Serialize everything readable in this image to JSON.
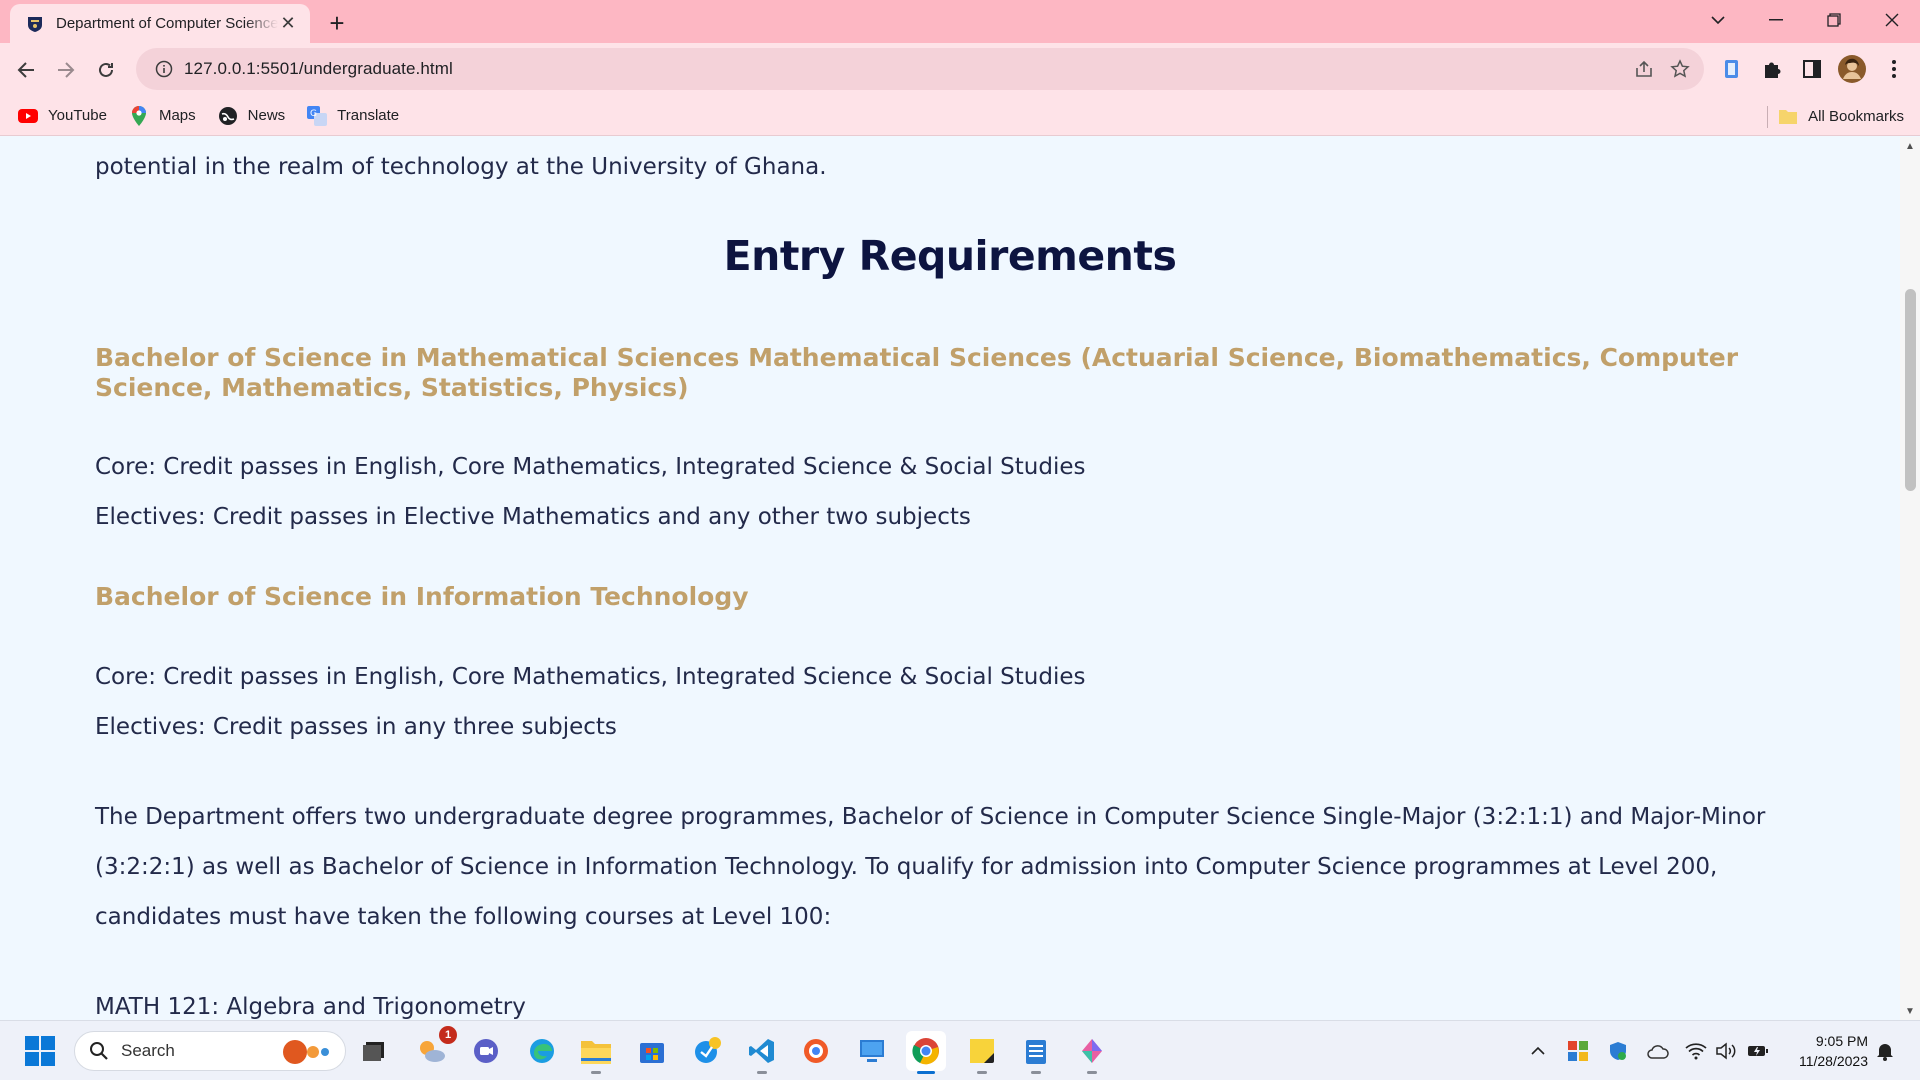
{
  "browser": {
    "tab_title": "Department of Computer Science",
    "url": "127.0.0.1:5501/undergraduate.html",
    "bookmarks": [
      {
        "label": "YouTube",
        "icon": "youtube-icon"
      },
      {
        "label": "Maps",
        "icon": "maps-icon"
      },
      {
        "label": "News",
        "icon": "news-icon"
      },
      {
        "label": "Translate",
        "icon": "translate-icon"
      }
    ],
    "all_bookmarks": "All Bookmarks"
  },
  "page": {
    "intro_tail": "potential in the realm of technology at the University of Ghana.",
    "heading": "Entry Requirements",
    "programmes": [
      {
        "title": "Bachelor of Science in Mathematical Sciences Mathematical Sciences (Actuarial Science, Biomathematics, Computer Science, Mathematics, Statistics, Physics)",
        "core": "Core: Credit passes in English, Core Mathematics, Integrated Science & Social Studies",
        "electives": "Electives: Credit passes in Elective Mathematics and any other two subjects"
      },
      {
        "title": "Bachelor of Science in Information Technology",
        "core": "Core: Credit passes in English, Core Mathematics, Integrated Science & Social Studies",
        "electives": "Electives: Credit passes in any three subjects"
      }
    ],
    "offer_text": "The Department offers two undergraduate degree programmes, Bachelor of Science in Computer Science Single-Major (3:2:1:1) and Major-Minor (3:2:2:1) as well as Bachelor of Science in Information Technology. To qualify for admission into Computer Science programmes at Level 200, candidates must have taken the following courses at Level 100:",
    "course_1": "MATH 121: Algebra and Trigonometry"
  },
  "taskbar": {
    "search_placeholder": "Search",
    "chat_badge": "1",
    "time": "9:05 PM",
    "date": "11/28/2023"
  },
  "colors": {
    "title_bar": "#fdb7c3",
    "toolbar": "#fee3e8",
    "page_bg": "#f0f8ff",
    "heading": "#0d1440",
    "subheading": "#c1a06a",
    "body_text": "#232a4a"
  }
}
